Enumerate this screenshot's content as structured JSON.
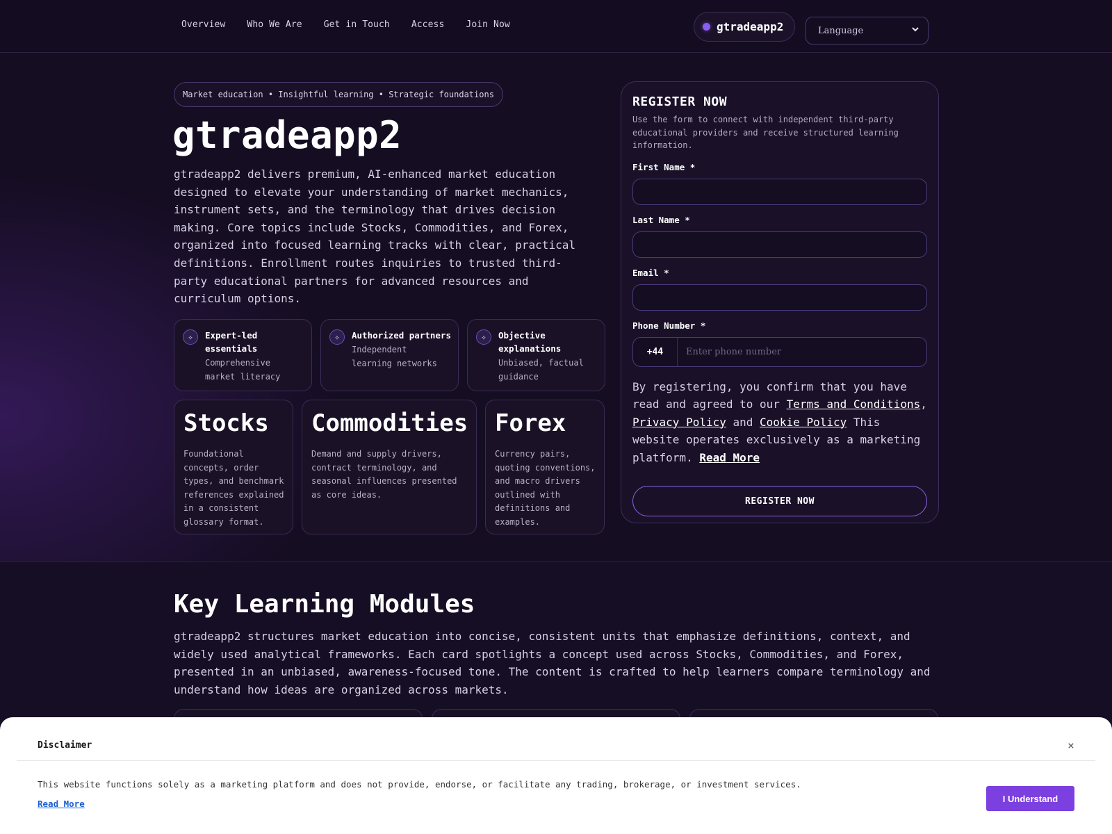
{
  "nav": {
    "items": [
      "Overview",
      "Who We Are",
      "Get in Touch",
      "Access",
      "Join Now"
    ]
  },
  "brand": {
    "name": "gtradeapp2"
  },
  "language": {
    "selected": "Language"
  },
  "hero": {
    "tagline": "Market education • Insightful learning • Strategic foundations",
    "title": "gtradeapp2",
    "description": "gtradeapp2 delivers premium, AI-enhanced market education designed to elevate your understanding of market mechanics, instrument sets, and the terminology that drives decision making. Core topics include Stocks, Commodities, and Forex, organized into focused learning tracks with clear, practical definitions. Enrollment routes inquiries to trusted third-party educational partners for advanced resources and curriculum options."
  },
  "features": [
    {
      "title": "Expert-led essentials",
      "subtitle": "Comprehensive market literacy"
    },
    {
      "title": "Authorized partners",
      "subtitle": "Independent learning networks"
    },
    {
      "title": "Objective explanations",
      "subtitle": "Unbiased, factual guidance"
    }
  ],
  "markets": [
    {
      "title": "Stocks",
      "description": "Foundational concepts, order types, and benchmark references explained in a consistent glossary format."
    },
    {
      "title": "Commodities",
      "description": "Demand and supply drivers, contract terminology, and seasonal influences presented as core ideas."
    },
    {
      "title": "Forex",
      "description": "Currency pairs, quoting conventions, and macro drivers outlined with definitions and examples."
    }
  ],
  "register": {
    "title": "REGISTER NOW",
    "subtitle": "Use the form to connect with independent third-party educational providers and receive structured learning information.",
    "first_name_label": "First Name *",
    "last_name_label": "Last Name *",
    "email_label": "Email *",
    "phone_label": "Phone Number *",
    "phone_code": "+44",
    "phone_placeholder": "Enter phone number",
    "consent_prefix": "By registering, you confirm that you have read and agreed to our ",
    "terms_link": "Terms and Conditions",
    "comma": ",",
    "privacy_link": "Privacy Policy",
    "and_text": " and ",
    "cookie_link": "Cookie Policy",
    "consent_suffix": " This website operates exclusively as a marketing platform. ",
    "read_more_link": "Read More",
    "button_label": "REGISTER NOW"
  },
  "modules": {
    "title": "Key Learning Modules",
    "description": "gtradeapp2 structures market education into concise, consistent units that emphasize definitions, context, and widely used analytical frameworks. Each card spotlights a concept used across Stocks, Commodities, and Forex, presented in an unbiased, awareness-focused tone. The content is crafted to help learners compare terminology and understand how ideas are organized across markets."
  },
  "disclaimer": {
    "title": "Disclaimer",
    "close_glyph": "×",
    "text": "This website functions solely as a marketing platform and does not provide, endorse, or facilitate any trading, brokerage, or investment services.",
    "read_more": "Read More",
    "button_label": "I Understand"
  },
  "icons": {
    "feature_icon": "sparkle-icon",
    "chevron": "chevron-down-icon"
  },
  "colors": {
    "accent": "#8a5cf0",
    "background": "#150d22",
    "disclaimer_button": "#7c3fe0",
    "link": "#1a5fd0"
  }
}
